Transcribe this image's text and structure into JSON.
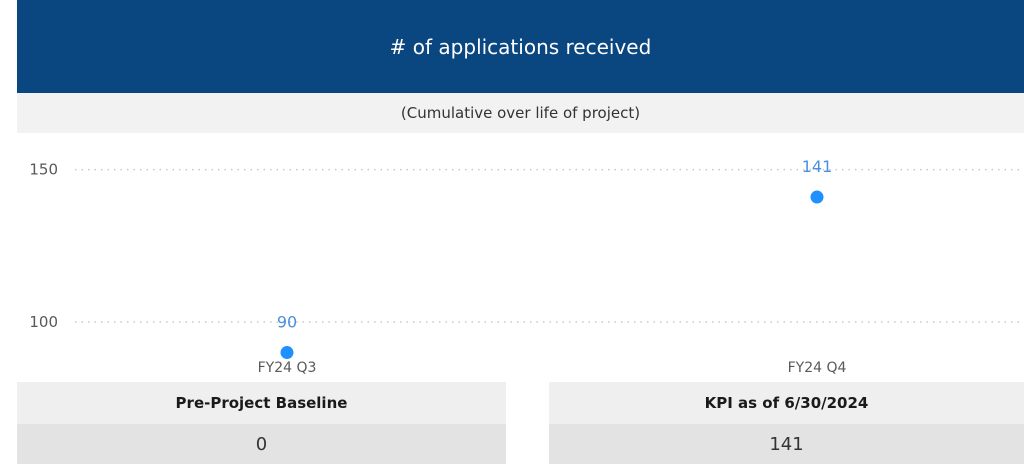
{
  "header": {
    "title": "# of applications received"
  },
  "subtitle": "(Cumulative over life of project)",
  "chart_data": {
    "type": "scatter",
    "categories": [
      "FY24 Q3",
      "FY24 Q4"
    ],
    "values": [
      90,
      141
    ],
    "data_labels": [
      "90",
      "141"
    ],
    "yticks": [
      100,
      150
    ],
    "ylim": [
      81,
      162
    ],
    "grid": true,
    "point_color": "#1e90ff",
    "label_color": "#4a8fe0"
  },
  "cards": {
    "baseline": {
      "label": "Pre-Project Baseline",
      "value": "0"
    },
    "kpi": {
      "label": "KPI as of 6/30/2024",
      "value": "141"
    }
  }
}
